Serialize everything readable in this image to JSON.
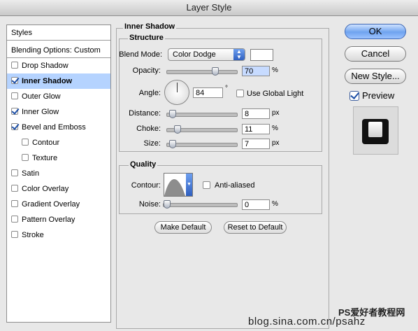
{
  "window": {
    "title": "Layer Style"
  },
  "styles_list": {
    "header_styles": "Styles",
    "header_blending": "Blending Options: Custom",
    "items": [
      {
        "label": "Drop Shadow",
        "checked": false
      },
      {
        "label": "Inner Shadow",
        "checked": true,
        "selected": true
      },
      {
        "label": "Outer Glow",
        "checked": false
      },
      {
        "label": "Inner Glow",
        "checked": true
      },
      {
        "label": "Bevel and Emboss",
        "checked": true
      },
      {
        "label": "Contour",
        "checked": false,
        "indent": true
      },
      {
        "label": "Texture",
        "checked": false,
        "indent": true
      },
      {
        "label": "Satin",
        "checked": false
      },
      {
        "label": "Color Overlay",
        "checked": false
      },
      {
        "label": "Gradient Overlay",
        "checked": false
      },
      {
        "label": "Pattern Overlay",
        "checked": false
      },
      {
        "label": "Stroke",
        "checked": false
      }
    ]
  },
  "panel": {
    "title": "Inner Shadow",
    "structure": {
      "title": "Structure",
      "blend_mode_label": "Blend Mode:",
      "blend_mode_value": "Color Dodge",
      "blend_color": "#ffffff",
      "opacity_label": "Opacity:",
      "opacity_value": "70",
      "opacity_unit": "%",
      "opacity_level": 0.7,
      "angle_label": "Angle:",
      "angle_value": "84",
      "angle_unit": "°",
      "use_global_light": "Use Global Light",
      "distance_label": "Distance:",
      "distance_value": "8",
      "distance_unit": "px",
      "distance_level": 0.032,
      "choke_label": "Choke:",
      "choke_value": "11",
      "choke_unit": "%",
      "choke_level": 0.11,
      "size_label": "Size:",
      "size_value": "7",
      "size_unit": "px",
      "size_level": 0.028
    },
    "quality": {
      "title": "Quality",
      "contour_label": "Contour:",
      "anti_aliased": "Anti-aliased",
      "noise_label": "Noise:",
      "noise_value": "0",
      "noise_unit": "%",
      "noise_level": 0
    },
    "make_default": "Make Default",
    "reset_default": "Reset to Default"
  },
  "buttons": {
    "ok": "OK",
    "cancel": "Cancel",
    "new_style": "New Style...",
    "preview": "Preview"
  },
  "watermark": {
    "line1": "PS爱好者教程网",
    "line2": "blog.sina.com.cn/psahz"
  },
  "colors": {
    "ok_button": "#6fa3ef",
    "selected_row": "#b5d3ff",
    "check": "#1d4fa6"
  }
}
